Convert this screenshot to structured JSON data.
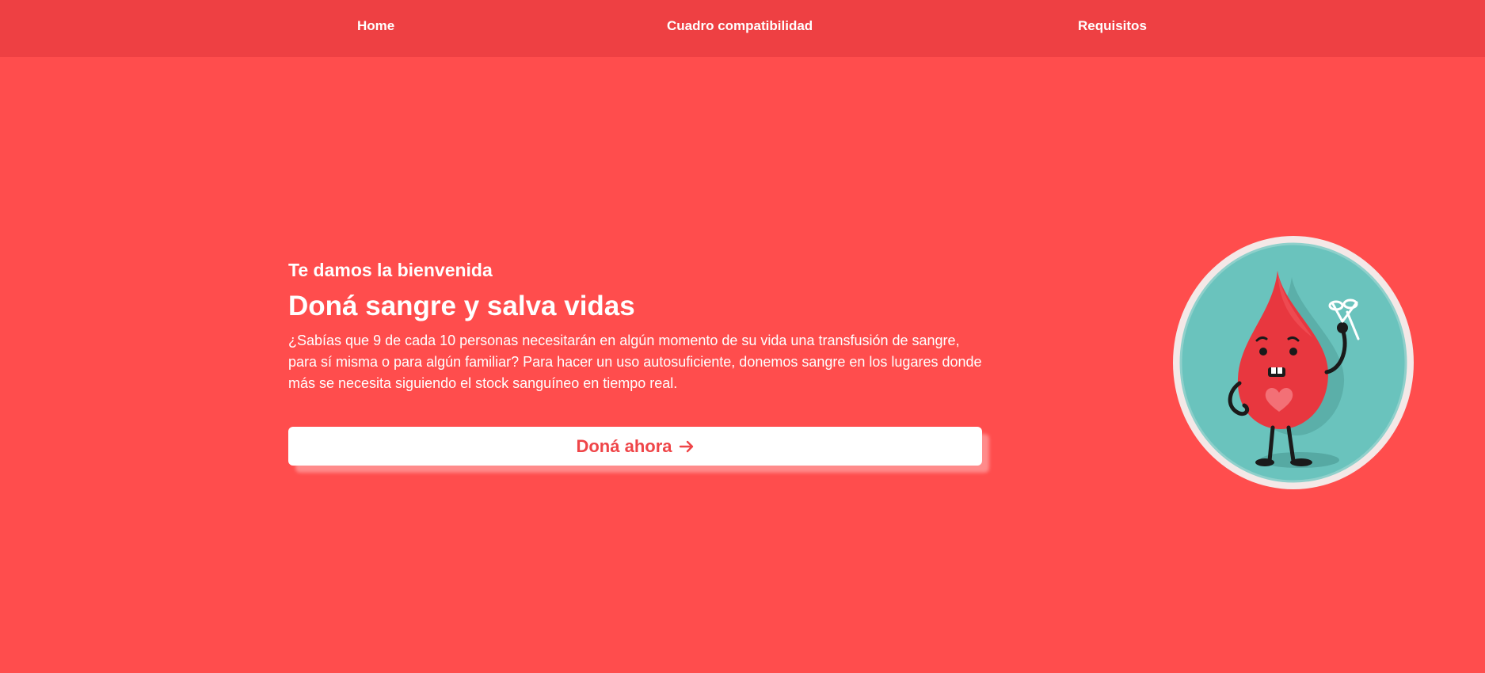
{
  "nav": {
    "items": [
      {
        "label": "Home"
      },
      {
        "label": "Cuadro compatibilidad"
      },
      {
        "label": "Requisitos"
      }
    ]
  },
  "hero": {
    "subtitle": "Te damos la bienvenida",
    "title": "Doná sangre y salva vidas",
    "body": "¿Sabías que 9 de cada 10 personas necesitarán en algún momento de su vida una transfusión de sangre, para sí misma o para algún familiar? Para hacer un uso autosuficiente, donemos sangre en los lugares donde más se necesita siguiendo el stock sanguíneo en tiempo real.",
    "cta_label": "Doná ahora",
    "cta_icon": "arrow-right-icon"
  },
  "illustration": {
    "icon": "blood-drop-mascot-icon"
  },
  "colors": {
    "background": "#ff4d4d",
    "nav_background": "#ee4043",
    "accent": "#ef4548",
    "circle_teal": "#6ac3bd"
  }
}
